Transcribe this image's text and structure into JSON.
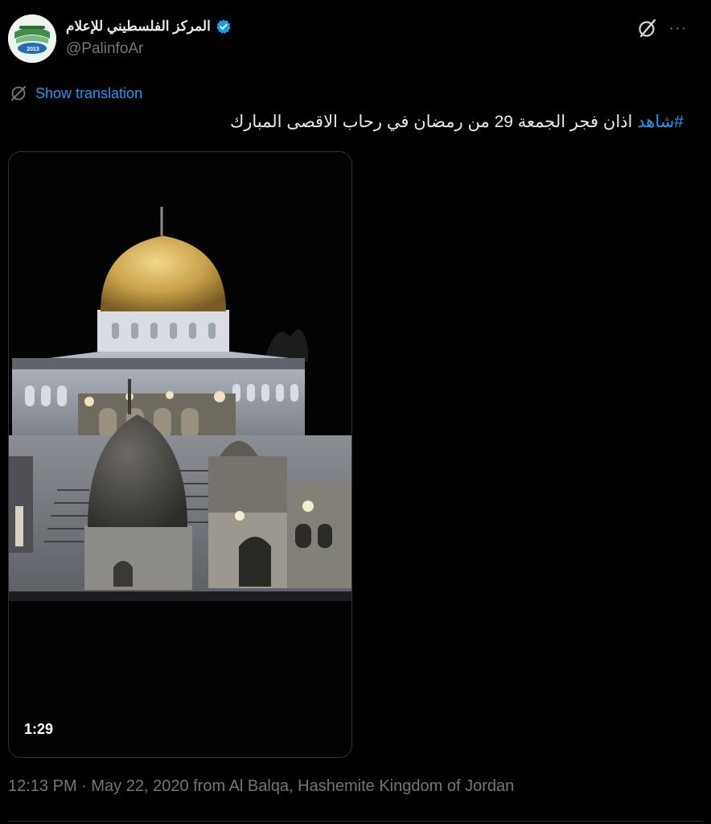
{
  "author": {
    "display_name": "المركز الفلسطيني للإعلام",
    "handle": "@PalinfoAr",
    "verified": true,
    "avatar_icon": "palinfo-logo",
    "avatar_logo_text": "2013"
  },
  "header_actions": {
    "grok_icon": "grok-icon",
    "more_icon": "more-icon",
    "more_label": "···"
  },
  "translation": {
    "label": "Show translation",
    "icon": "translate-icon"
  },
  "tweet": {
    "hashtag": "#شاهد",
    "text": "اذان فجر الجمعة 29 من رمضان في رحاب الاقصى المبارك"
  },
  "media": {
    "type": "video",
    "description_icon": "dome-of-the-rock-video",
    "duration": "1:29"
  },
  "meta": {
    "timestamp_and_location": "12:13 PM · May 22, 2020 from Al Balqa, Hashemite Kingdom of Jordan"
  },
  "colors": {
    "background": "#000000",
    "accent": "#1d9bf0",
    "text_primary": "#e7e9ea",
    "text_secondary": "#71767b",
    "border": "#2f3336"
  }
}
